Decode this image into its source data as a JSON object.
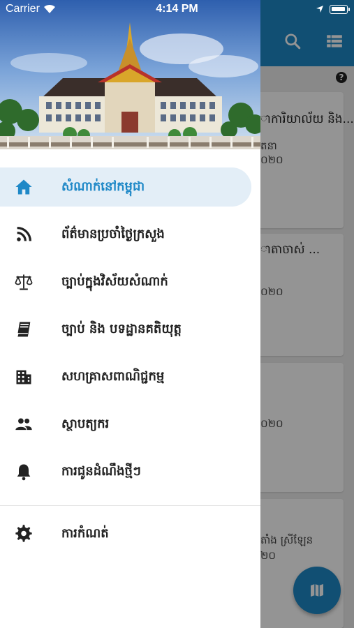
{
  "status_bar": {
    "carrier": "Carrier",
    "time": "4:14 PM"
  },
  "colors": {
    "primary": "#1e88c7",
    "active_bg": "#e3eef7",
    "text": "#222222"
  },
  "drawer": {
    "header_image": "court-building-illustration",
    "items": [
      {
        "label": "សំណាក់នៅកម្ពុជា",
        "icon": "home-icon",
        "active": true
      },
      {
        "label": "ព័ត៌មានប្រចាំថ្ងៃក្រសួង",
        "icon": "rss-icon",
        "active": false
      },
      {
        "label": "ច្បាប់ក្នុងវិស័យសំណាក់",
        "icon": "scale-icon",
        "active": false
      },
      {
        "label": "ច្បាប់ និង បទដ្ឋានគតិយុត្ត",
        "icon": "book-icon",
        "active": false
      },
      {
        "label": "សហគ្រាសពាណិជ្ជកម្ម",
        "icon": "building-icon",
        "active": false
      },
      {
        "label": "ស្ថាបត្យករ",
        "icon": "people-icon",
        "active": false
      },
      {
        "label": "ការជូនដំណឹងថ្មីៗ",
        "icon": "bell-icon",
        "active": false
      }
    ],
    "settings": {
      "label": "ការកំណត់",
      "icon": "gear-icon"
    }
  },
  "background": {
    "appbar_icons": [
      "search-icon",
      "list-icon"
    ],
    "cards": [
      {
        "title": "ាការិយាល័យ និង...",
        "meta1": "តនា",
        "meta2": "០២០"
      },
      {
        "title": "ាតាចាស់ ...",
        "meta1": "០២០",
        "meta2": ""
      },
      {
        "title": "",
        "meta1": "០២០",
        "meta2": ""
      },
      {
        "title": "",
        "meta1": "តាំង ស្រីឡែន",
        "meta2": "២០"
      }
    ],
    "fab_icon": "map-icon"
  }
}
